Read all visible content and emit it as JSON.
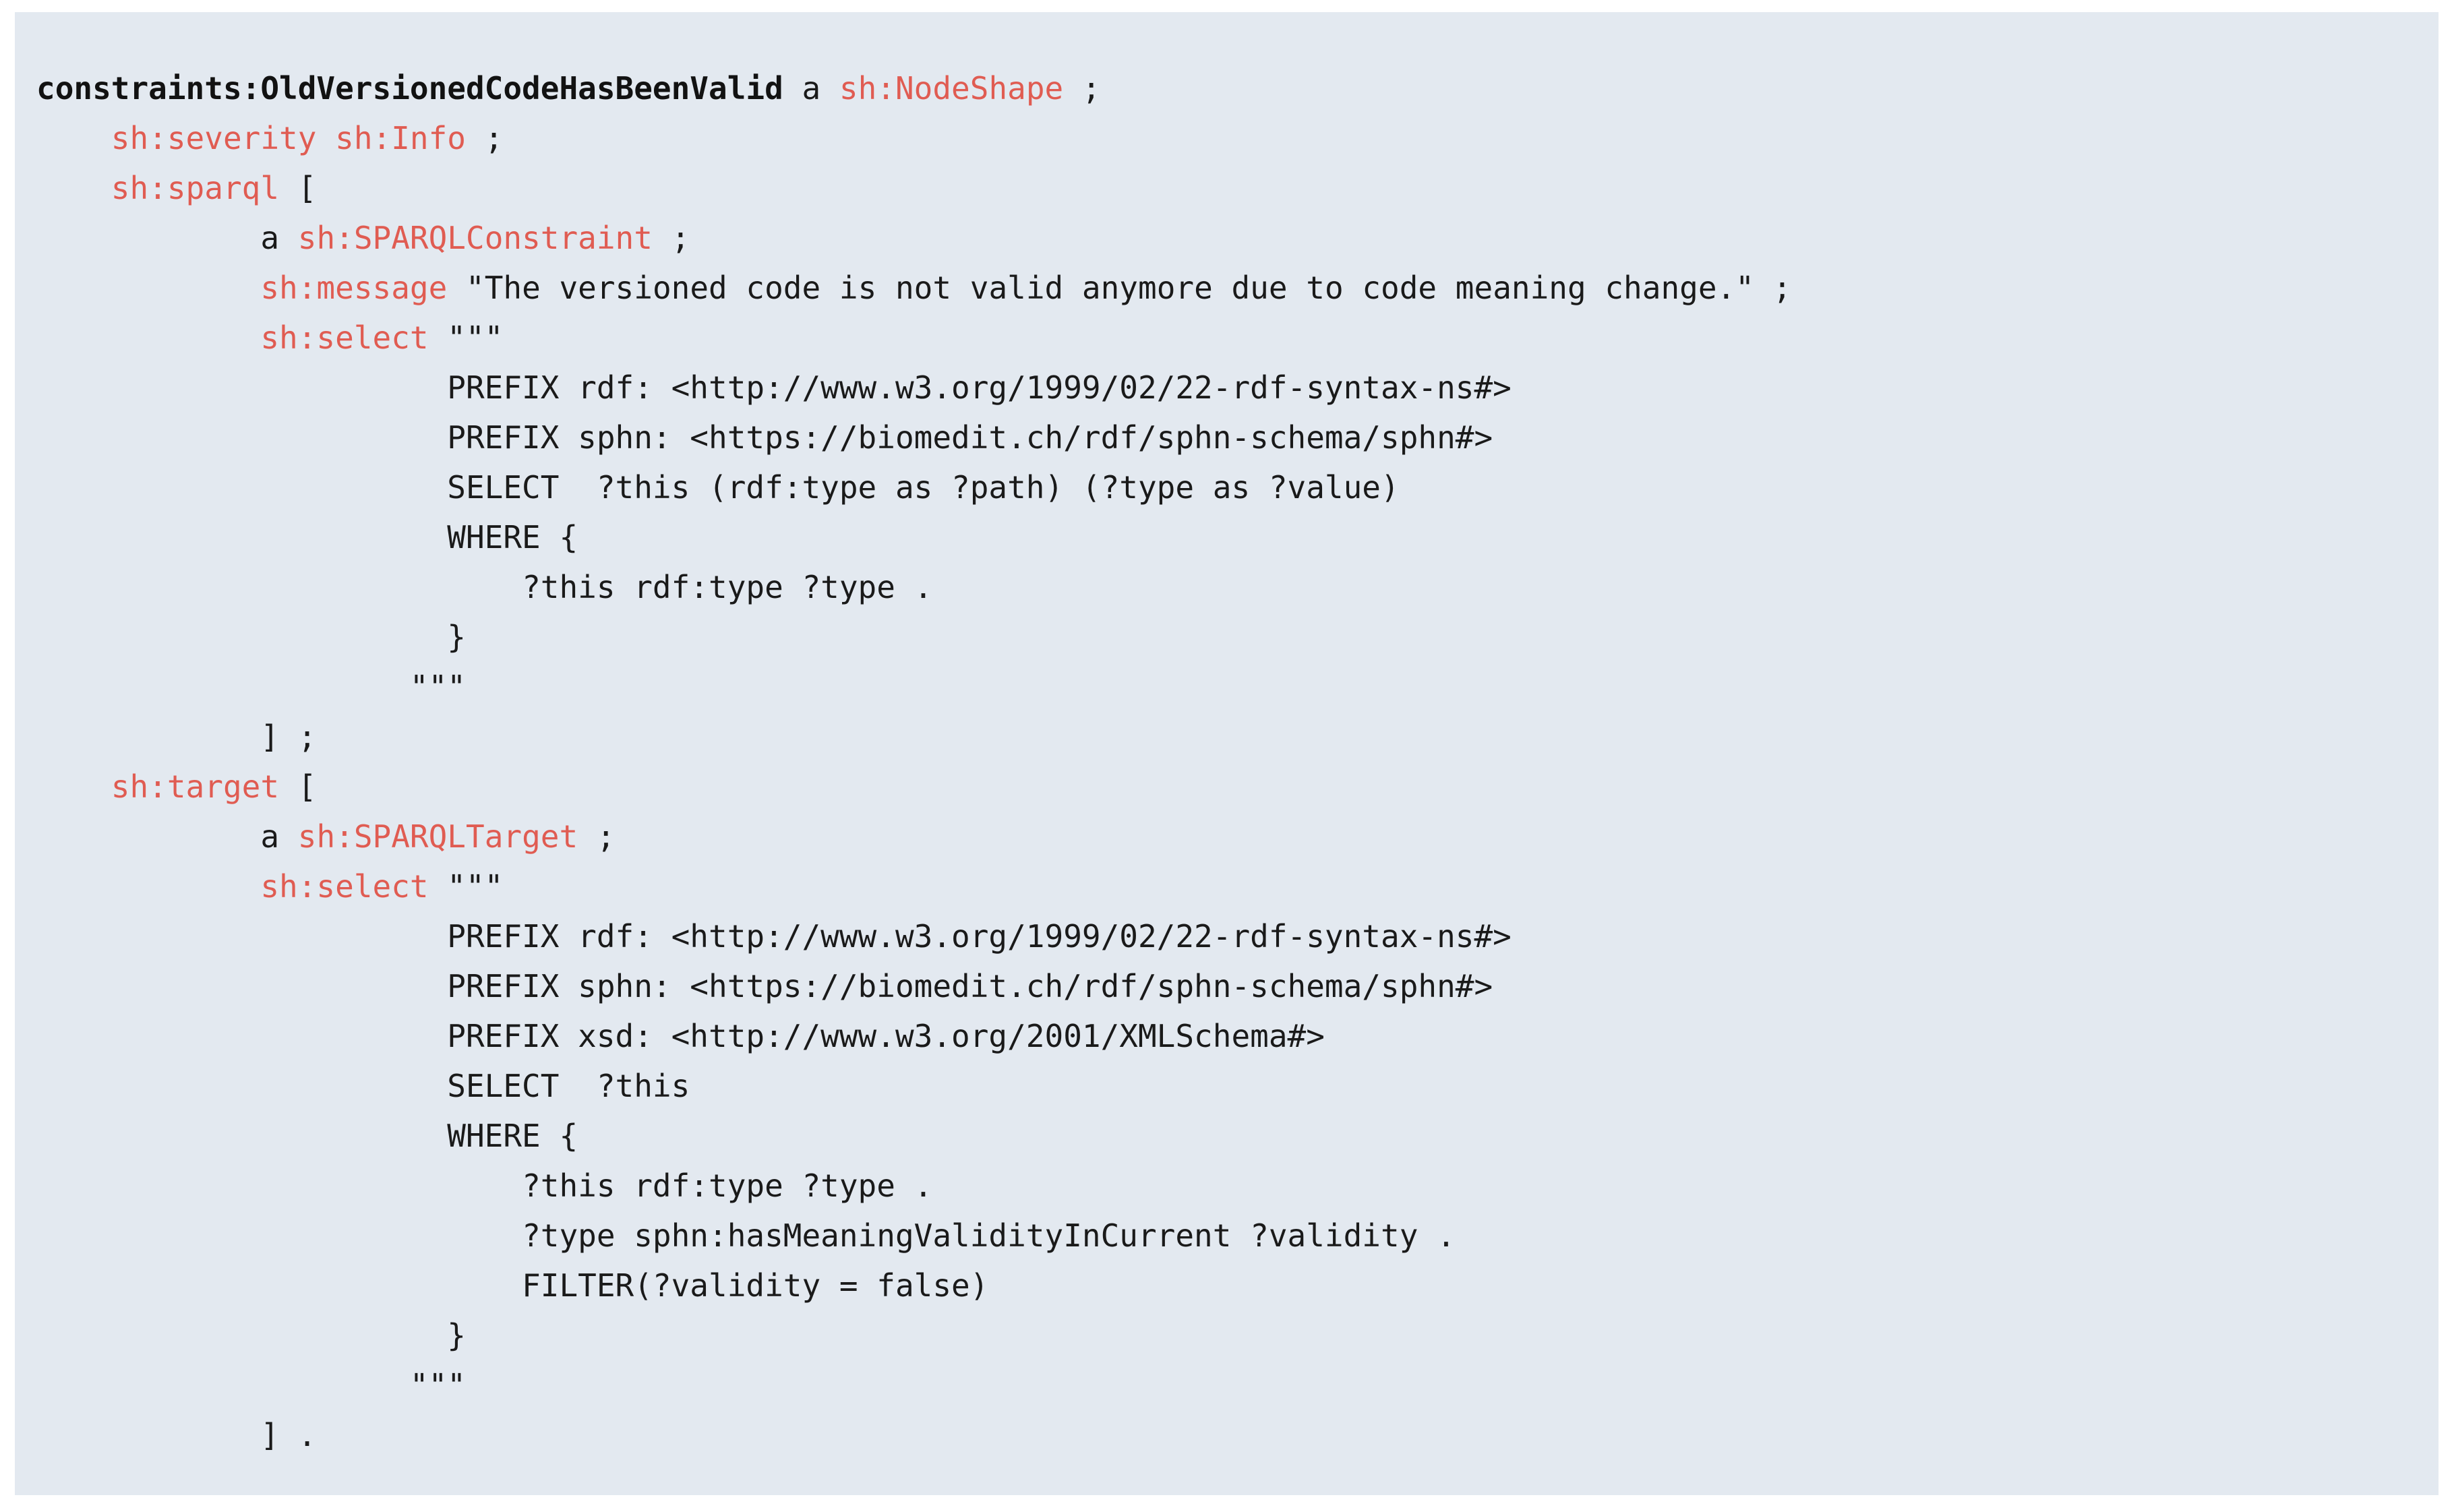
{
  "figure": {
    "kind": "code-listing",
    "language": "turtle-shacl",
    "background_color": "#e3e9f0",
    "page_background_color": "#ffffff",
    "default_text_color": "#1a1a1a",
    "accent_text_color": "#e05c52",
    "indent_unit_spaces": 4,
    "line_count": 28
  },
  "code": {
    "plain_text": "constraints:OldVersionedCodeHasBeenValid a sh:NodeShape ;\n    sh:severity sh:Info ;\n    sh:sparql [\n        a sh:SPARQLConstraint ;\n        sh:message \"The versioned code is not valid anymore due to code meaning change.\" ;\n        sh:select \"\"\"\n            PREFIX rdf: <http://www.w3.org/1999/02/22-rdf-syntax-ns#>\n            PREFIX sphn: <https://biomedit.ch/rdf/sphn-schema/sphn#>\n            SELECT  ?this (rdf:type as ?path) (?type as ?value)\n            WHERE {\n                ?this rdf:type ?type .\n            }\n        \"\"\"\n    ] ;\n    sh:target [\n        a sh:SPARQLTarget ;\n        sh:select \"\"\"\n            PREFIX rdf: <http://www.w3.org/1999/02/22-rdf-syntax-ns#>\n            PREFIX sphn: <https://biomedit.ch/rdf/sphn-schema/sphn#>\n            PREFIX xsd: <http://www.w3.org/2001/XMLSchema#>\n            SELECT  ?this\n            WHERE {\n                ?this rdf:type ?type .\n                ?type sphn:hasMeaningValidityInCurrent ?validity .\n                FILTER(?validity = false)\n            }\n        \"\"\"\n    ] .",
    "lines": [
      {
        "indent": 0,
        "tokens": [
          {
            "t": "constraints:OldVersionedCodeHasBeenValid",
            "c": "subject"
          },
          {
            "t": " ",
            "c": "plain"
          },
          {
            "t": "a",
            "c": "plain"
          },
          {
            "t": " ",
            "c": "plain"
          },
          {
            "t": "sh:NodeShape",
            "c": "sh"
          },
          {
            "t": " ;",
            "c": "punct"
          }
        ]
      },
      {
        "indent": 4,
        "tokens": [
          {
            "t": "sh:severity",
            "c": "sh"
          },
          {
            "t": " ",
            "c": "plain"
          },
          {
            "t": "sh:Info",
            "c": "sh"
          },
          {
            "t": " ;",
            "c": "punct"
          }
        ]
      },
      {
        "indent": 4,
        "tokens": [
          {
            "t": "sh:sparql",
            "c": "sh"
          },
          {
            "t": " [",
            "c": "punct"
          }
        ]
      },
      {
        "indent": 12,
        "tokens": [
          {
            "t": "a",
            "c": "plain"
          },
          {
            "t": " ",
            "c": "plain"
          },
          {
            "t": "sh:SPARQLConstraint",
            "c": "sh"
          },
          {
            "t": " ;",
            "c": "punct"
          }
        ]
      },
      {
        "indent": 12,
        "tokens": [
          {
            "t": "sh:message",
            "c": "sh"
          },
          {
            "t": " ",
            "c": "plain"
          },
          {
            "t": "\"The versioned code is not valid anymore due to code meaning change.\"",
            "c": "string"
          },
          {
            "t": " ;",
            "c": "punct"
          }
        ]
      },
      {
        "indent": 12,
        "tokens": [
          {
            "t": "sh:select",
            "c": "sh"
          },
          {
            "t": " ",
            "c": "plain"
          },
          {
            "t": "\"\"\"",
            "c": "string"
          }
        ]
      },
      {
        "indent": 22,
        "tokens": [
          {
            "t": "PREFIX rdf: <http://www.w3.org/1999/02/22-rdf-syntax-ns#>",
            "c": "plain"
          }
        ]
      },
      {
        "indent": 22,
        "tokens": [
          {
            "t": "PREFIX sphn: <https://biomedit.ch/rdf/sphn-schema/sphn#>",
            "c": "plain"
          }
        ]
      },
      {
        "indent": 22,
        "tokens": [
          {
            "t": "SELECT  ?this (rdf:type as ?path) (?type as ?value)",
            "c": "plain"
          }
        ]
      },
      {
        "indent": 22,
        "tokens": [
          {
            "t": "WHERE {",
            "c": "plain"
          }
        ]
      },
      {
        "indent": 26,
        "tokens": [
          {
            "t": "?this rdf:type ?type .",
            "c": "plain"
          }
        ]
      },
      {
        "indent": 22,
        "tokens": [
          {
            "t": "}",
            "c": "punct"
          }
        ]
      },
      {
        "indent": 20,
        "tokens": [
          {
            "t": "\"\"\"",
            "c": "string"
          }
        ]
      },
      {
        "indent": 12,
        "tokens": [
          {
            "t": "] ;",
            "c": "punct"
          }
        ]
      },
      {
        "indent": 4,
        "tokens": [
          {
            "t": "sh:target",
            "c": "sh"
          },
          {
            "t": " [",
            "c": "punct"
          }
        ]
      },
      {
        "indent": 12,
        "tokens": [
          {
            "t": "a",
            "c": "plain"
          },
          {
            "t": " ",
            "c": "plain"
          },
          {
            "t": "sh:SPARQLTarget",
            "c": "sh"
          },
          {
            "t": " ;",
            "c": "punct"
          }
        ]
      },
      {
        "indent": 12,
        "tokens": [
          {
            "t": "sh:select",
            "c": "sh"
          },
          {
            "t": " ",
            "c": "plain"
          },
          {
            "t": "\"\"\"",
            "c": "string"
          }
        ]
      },
      {
        "indent": 22,
        "tokens": [
          {
            "t": "PREFIX rdf: <http://www.w3.org/1999/02/22-rdf-syntax-ns#>",
            "c": "plain"
          }
        ]
      },
      {
        "indent": 22,
        "tokens": [
          {
            "t": "PREFIX sphn: <https://biomedit.ch/rdf/sphn-schema/sphn#>",
            "c": "plain"
          }
        ]
      },
      {
        "indent": 22,
        "tokens": [
          {
            "t": "PREFIX xsd: <http://www.w3.org/2001/XMLSchema#>",
            "c": "plain"
          }
        ]
      },
      {
        "indent": 22,
        "tokens": [
          {
            "t": "SELECT  ?this",
            "c": "plain"
          }
        ]
      },
      {
        "indent": 22,
        "tokens": [
          {
            "t": "WHERE {",
            "c": "plain"
          }
        ]
      },
      {
        "indent": 26,
        "tokens": [
          {
            "t": "?this rdf:type ?type .",
            "c": "plain"
          }
        ]
      },
      {
        "indent": 26,
        "tokens": [
          {
            "t": "?type sphn:hasMeaningValidityInCurrent ?validity .",
            "c": "plain"
          }
        ]
      },
      {
        "indent": 26,
        "tokens": [
          {
            "t": "FILTER(?validity = false)",
            "c": "plain"
          }
        ]
      },
      {
        "indent": 22,
        "tokens": [
          {
            "t": "}",
            "c": "punct"
          }
        ]
      },
      {
        "indent": 20,
        "tokens": [
          {
            "t": "\"\"\"",
            "c": "string"
          }
        ]
      },
      {
        "indent": 12,
        "tokens": [
          {
            "t": "] .",
            "c": "punct"
          }
        ]
      }
    ]
  }
}
